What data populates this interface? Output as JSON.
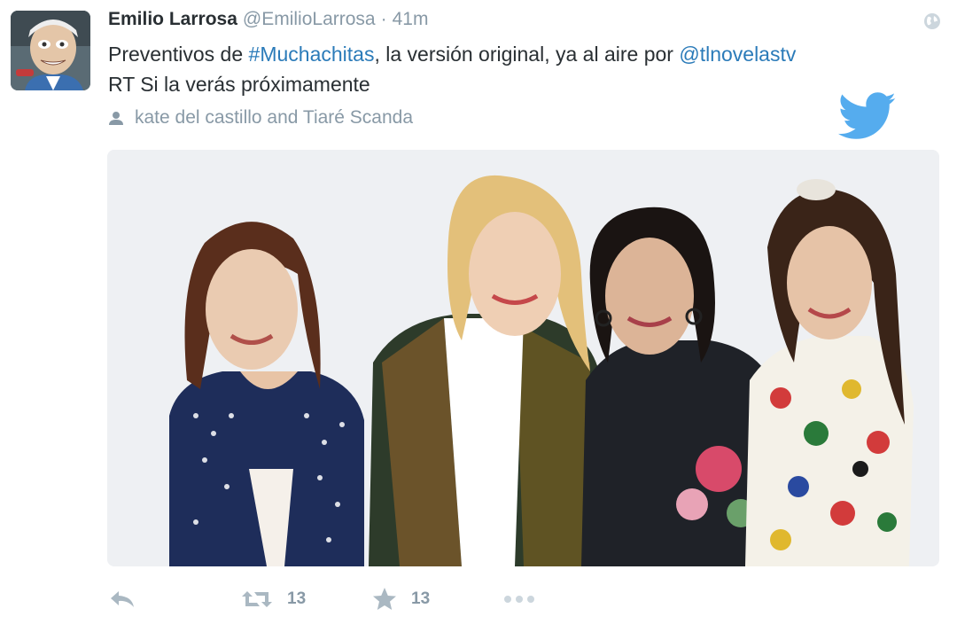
{
  "tweet": {
    "author": {
      "name": "Emilio Larrosa",
      "handle": "@EmilioLarrosa",
      "separator": "·",
      "timestamp": "41m"
    },
    "text": {
      "line1_part1": "Preventivos de ",
      "hashtag": "#Muchachitas",
      "line1_part2": ", la versión original, ya al aire por ",
      "mention": "@tlnovelastv",
      "line2": "RT Si la verás próximamente"
    },
    "tagged_people": "kate del castillo and Tiaré Scanda",
    "actions": {
      "retweet_count": "13",
      "favorite_count": "13"
    },
    "icons": {
      "globe": "globe-icon",
      "person": "person-icon",
      "bird": "twitter-bird-icon",
      "reply": "reply-icon",
      "retweet": "retweet-icon",
      "favorite": "star-icon",
      "more": "more-icon"
    },
    "colors": {
      "link": "#2b7bb9",
      "muted": "#8899a6",
      "text": "#292f33",
      "twitter_blue": "#55acee"
    }
  }
}
